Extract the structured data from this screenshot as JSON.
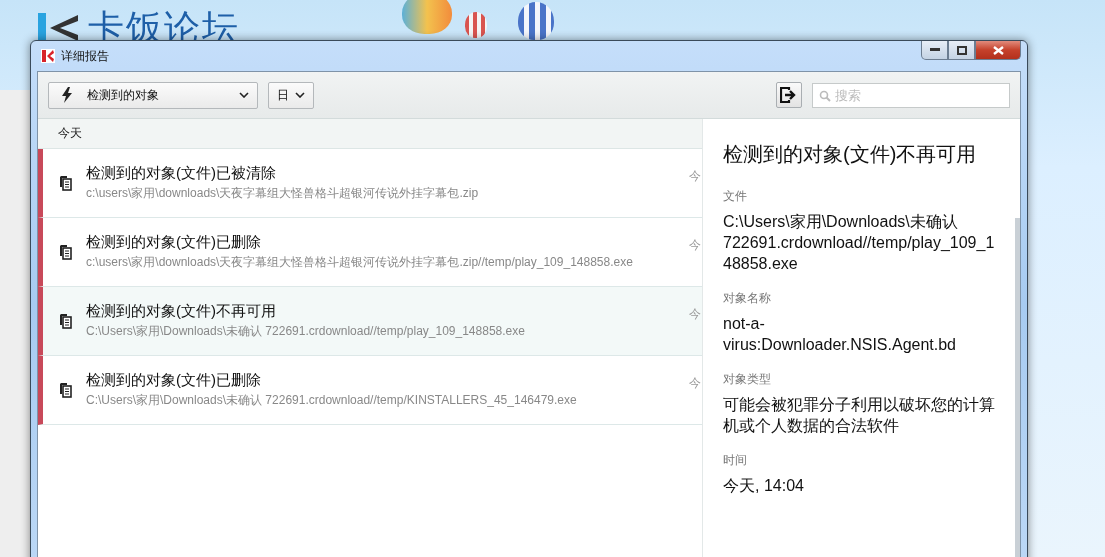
{
  "background_page": {
    "logo": "卡饭论坛"
  },
  "window": {
    "title": "详细报告"
  },
  "toolbar": {
    "filter_dropdown": "检测到的对象",
    "period_dropdown": "日",
    "search": {
      "placeholder": "搜索"
    }
  },
  "list": {
    "group": "今天",
    "items": [
      {
        "title": "检测到的对象(文件)已被清除",
        "path": "c:\\users\\家用\\downloads\\天夜字幕组大怪兽格斗超银河传说外挂字幕包.zip",
        "time": "今",
        "selected": false
      },
      {
        "title": "检测到的对象(文件)已删除",
        "path": "c:\\users\\家用\\downloads\\天夜字幕组大怪兽格斗超银河传说外挂字幕包.zip//temp/play_109_148858.exe",
        "time": "今",
        "selected": false
      },
      {
        "title": "检测到的对象(文件)不再可用",
        "path": "C:\\Users\\家用\\Downloads\\未确认 722691.crdownload//temp/play_109_148858.exe",
        "time": "今",
        "selected": true
      },
      {
        "title": "检测到的对象(文件)已删除",
        "path": "C:\\Users\\家用\\Downloads\\未确认 722691.crdownload//temp/KINSTALLERS_45_146479.exe",
        "time": "今",
        "selected": false
      }
    ]
  },
  "details": {
    "title": "检测到的对象(文件)不再可用",
    "fields": [
      {
        "label": "文件",
        "value": "C:\\Users\\家用\\Downloads\\未确认 722691.crdownload//temp/play_109_148858.exe"
      },
      {
        "label": "对象名称",
        "value": "not-a-virus:Downloader.NSIS.Agent.bd"
      },
      {
        "label": "对象类型",
        "value": "可能会被犯罪分子利用以破坏您的计算机或个人数据的合法软件"
      },
      {
        "label": "时间",
        "value": "今天, 14:04"
      }
    ]
  }
}
